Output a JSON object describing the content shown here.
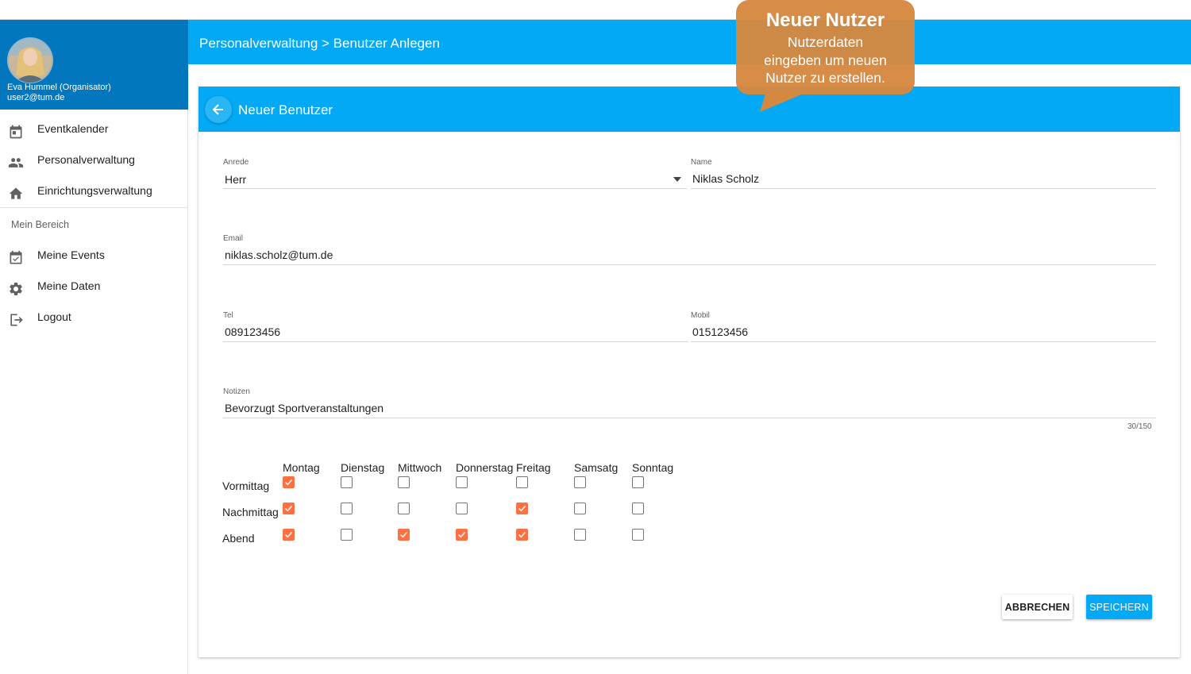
{
  "header": {
    "breadcrumb": "Personalverwaltung > Benutzer Anlegen"
  },
  "profile": {
    "name": "Eva Hummel (Organisator)",
    "email": "user2@tum.de"
  },
  "sidebar": {
    "items": [
      {
        "label": "Eventkalender",
        "icon": "calendar-icon"
      },
      {
        "label": "Personalverwaltung",
        "icon": "people-icon"
      },
      {
        "label": "Einrichtungsverwaltung",
        "icon": "home-icon"
      }
    ],
    "section_label": "Mein Bereich",
    "section_items": [
      {
        "label": "Meine Events",
        "icon": "calendar-check-icon"
      },
      {
        "label": "Meine Daten",
        "icon": "gear-icon"
      },
      {
        "label": "Logout",
        "icon": "logout-icon"
      }
    ]
  },
  "card": {
    "title": "Neuer Benutzer",
    "back_icon": "arrow-left-icon"
  },
  "form": {
    "anrede": {
      "label": "Anrede",
      "value": "Herr"
    },
    "name": {
      "label": "Name",
      "value": "Niklas Scholz"
    },
    "email": {
      "label": "Email",
      "value": "niklas.scholz@tum.de"
    },
    "tel": {
      "label": "Tel",
      "value": "089123456"
    },
    "mobil": {
      "label": "Mobil",
      "value": "015123456"
    },
    "notizen": {
      "label": "Notizen",
      "value": "Bevorzugt Sportveranstaltungen",
      "counter": "30/150"
    }
  },
  "availability": {
    "days": [
      "Montag",
      "Dienstag",
      "Mittwoch",
      "Donnerstag",
      "Freitag",
      "Samsatg",
      "Sonntag"
    ],
    "rows": [
      {
        "label": "Vormittag",
        "checked": [
          true,
          false,
          false,
          false,
          false,
          false,
          false
        ]
      },
      {
        "label": "Nachmittag",
        "checked": [
          true,
          false,
          false,
          false,
          true,
          false,
          false
        ]
      },
      {
        "label": "Abend",
        "checked": [
          true,
          false,
          true,
          true,
          true,
          false,
          false
        ]
      }
    ],
    "checked_color": "#ff7043"
  },
  "buttons": {
    "cancel": "ABBRECHEN",
    "save": "SPEICHERN"
  },
  "callout": {
    "title": "Neuer Nutzer",
    "lines": [
      "Nutzerdaten",
      "eingeben um neuen",
      "Nutzer zu erstellen."
    ]
  },
  "colors": {
    "primary": "#03a9f4",
    "profile_bg": "#0277bd",
    "callout_bg": "#d5883f"
  }
}
